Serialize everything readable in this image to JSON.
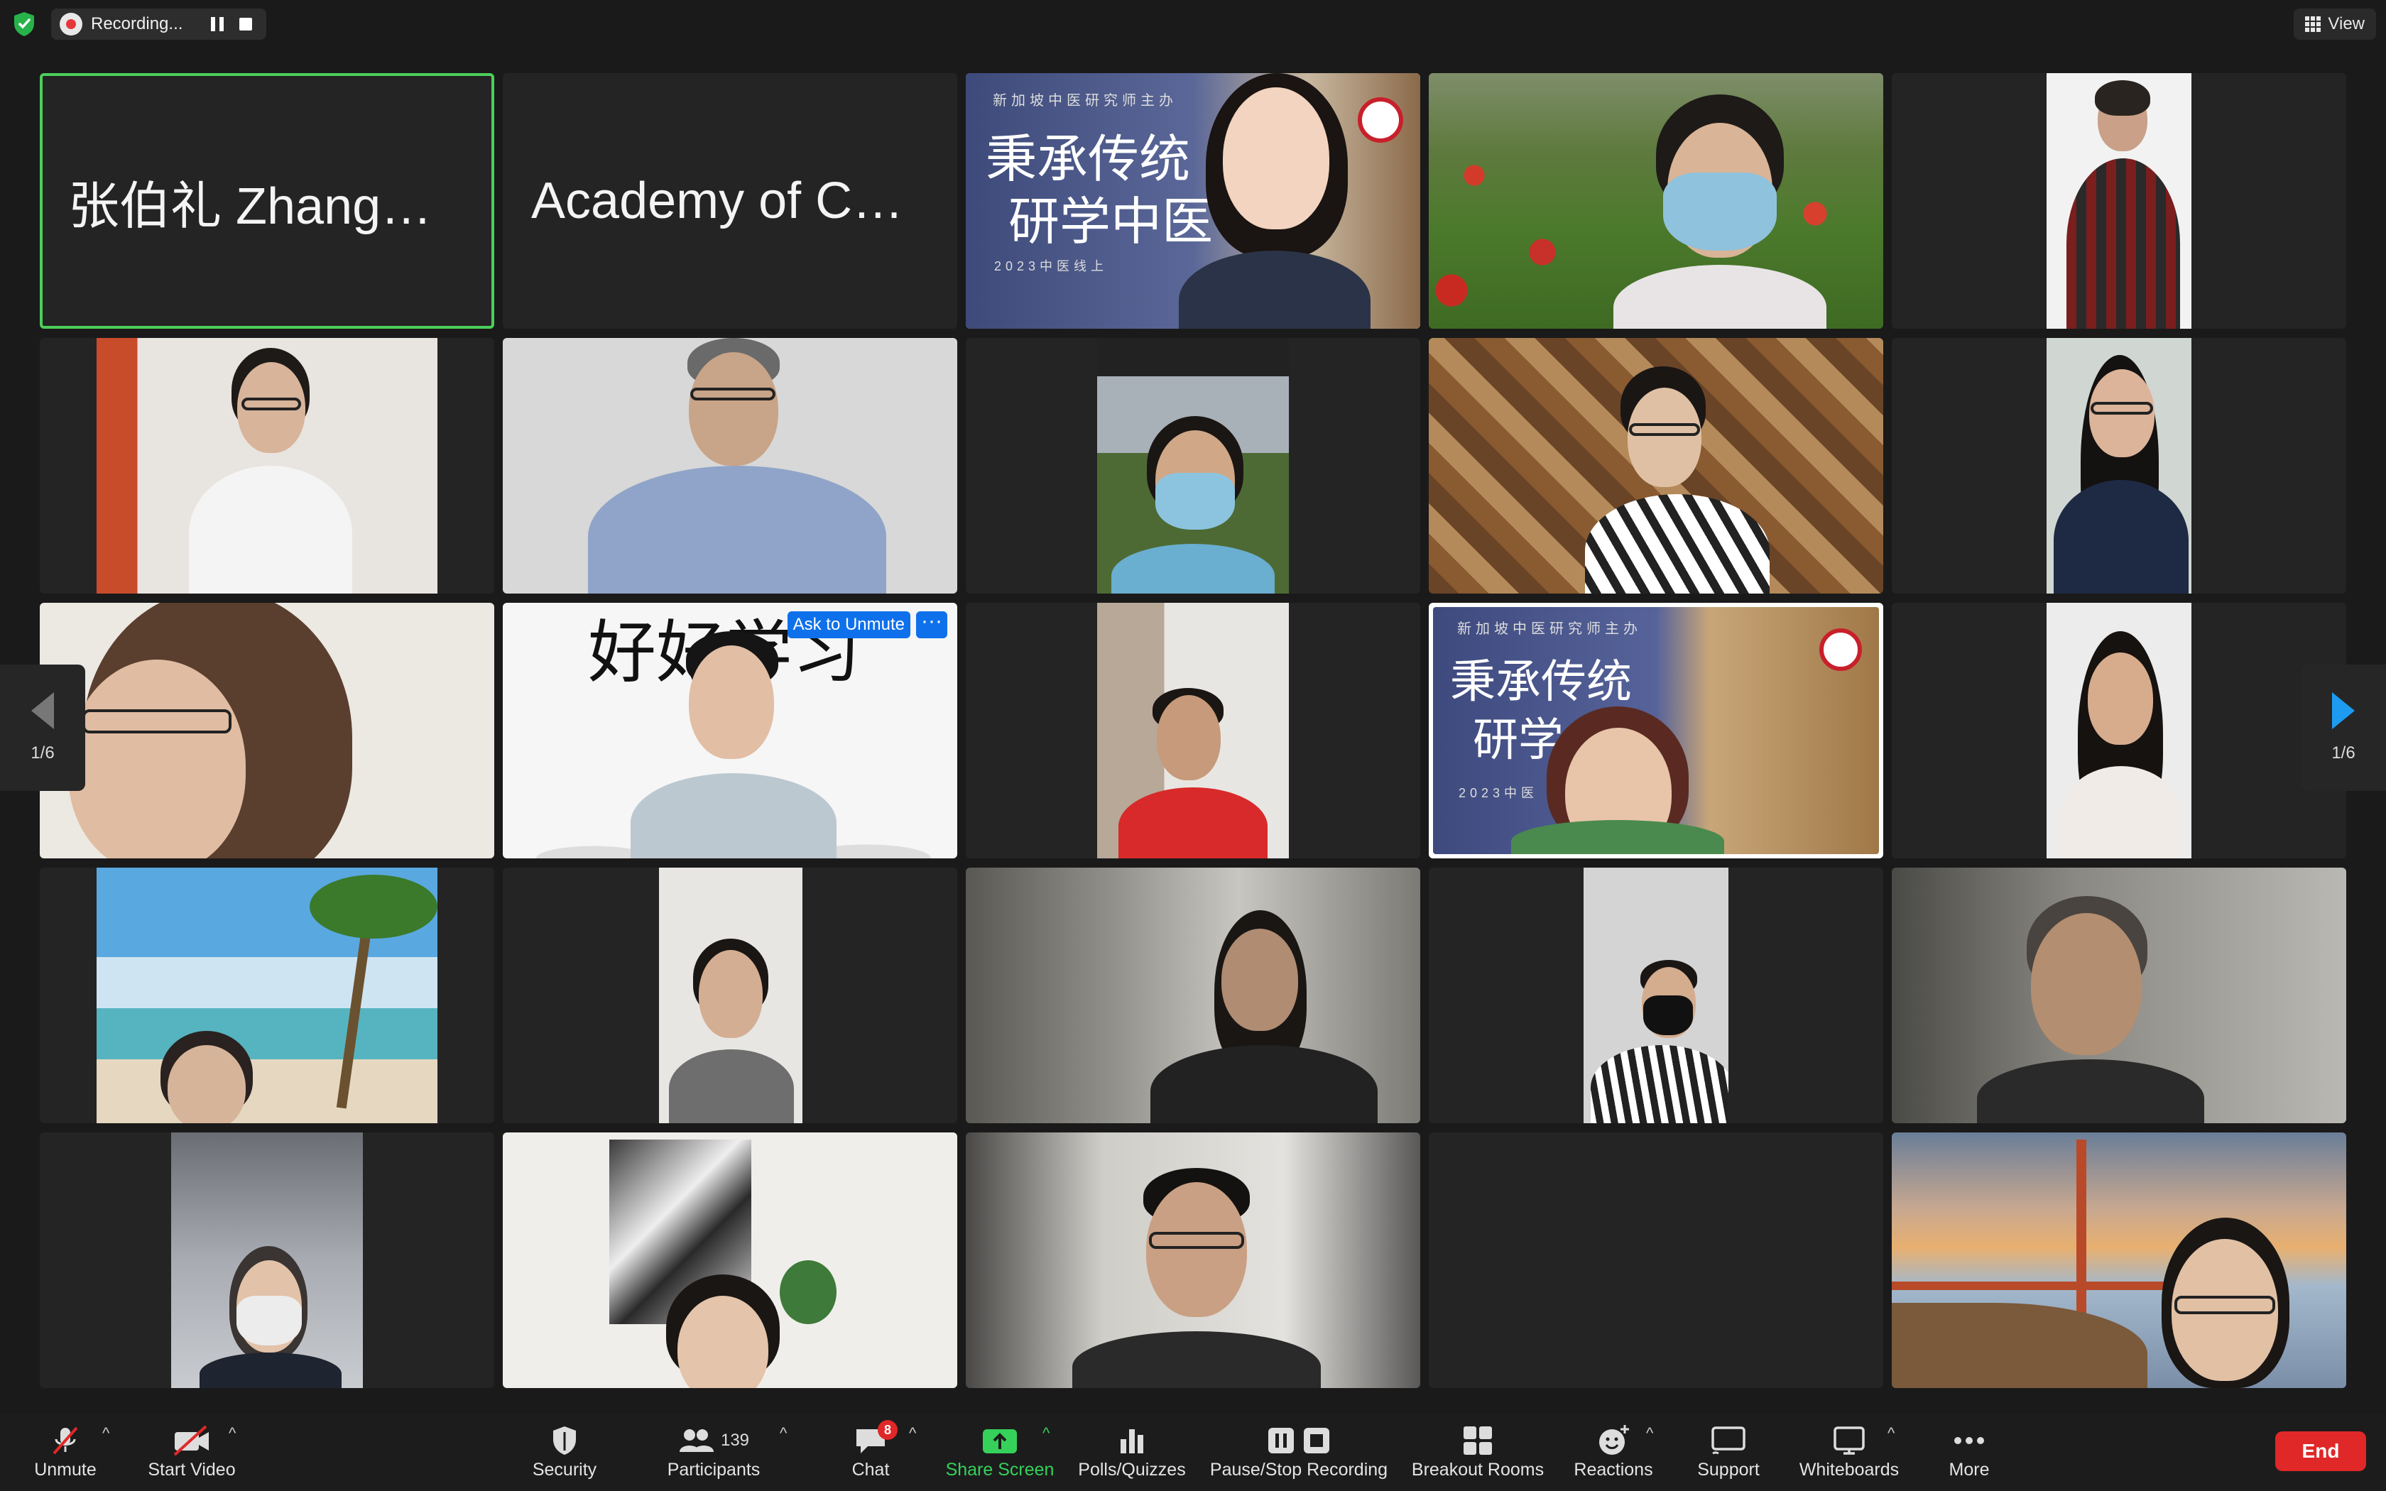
{
  "recording": {
    "label": "Recording..."
  },
  "view": {
    "label": "View"
  },
  "tiles": {
    "t1_name": "张伯礼  ZhangBoli",
    "t2_name": "Academy of Chin...",
    "banner_lines": [
      "新加坡中医研究师主办",
      "秉承传统",
      "研学中医",
      "2023中医线上"
    ],
    "banner2_lines": [
      "新加坡中医研究师主办",
      "秉承传统",
      "研学",
      "2023中医"
    ],
    "sign_text": "好好学习"
  },
  "ask_unmute": "Ask to Unmute",
  "more_dots": "···",
  "page": {
    "left": "1/6",
    "right": "1/6"
  },
  "toolbar": {
    "unmute": "Unmute",
    "start_video": "Start Video",
    "security": "Security",
    "participants": "Participants",
    "participants_count": "139",
    "chat": "Chat",
    "chat_badge": "8",
    "share_screen": "Share Screen",
    "polls": "Polls/Quizzes",
    "pause_stop": "Pause/Stop Recording",
    "breakout": "Breakout Rooms",
    "reactions": "Reactions",
    "support": "Support",
    "whiteboards": "Whiteboards",
    "more": "More",
    "end": "End"
  },
  "colors": {
    "active_speaker": "#4ccf5a",
    "share_green": "#35d15a",
    "end_red": "#e02828",
    "accent_blue": "#0e71eb"
  }
}
